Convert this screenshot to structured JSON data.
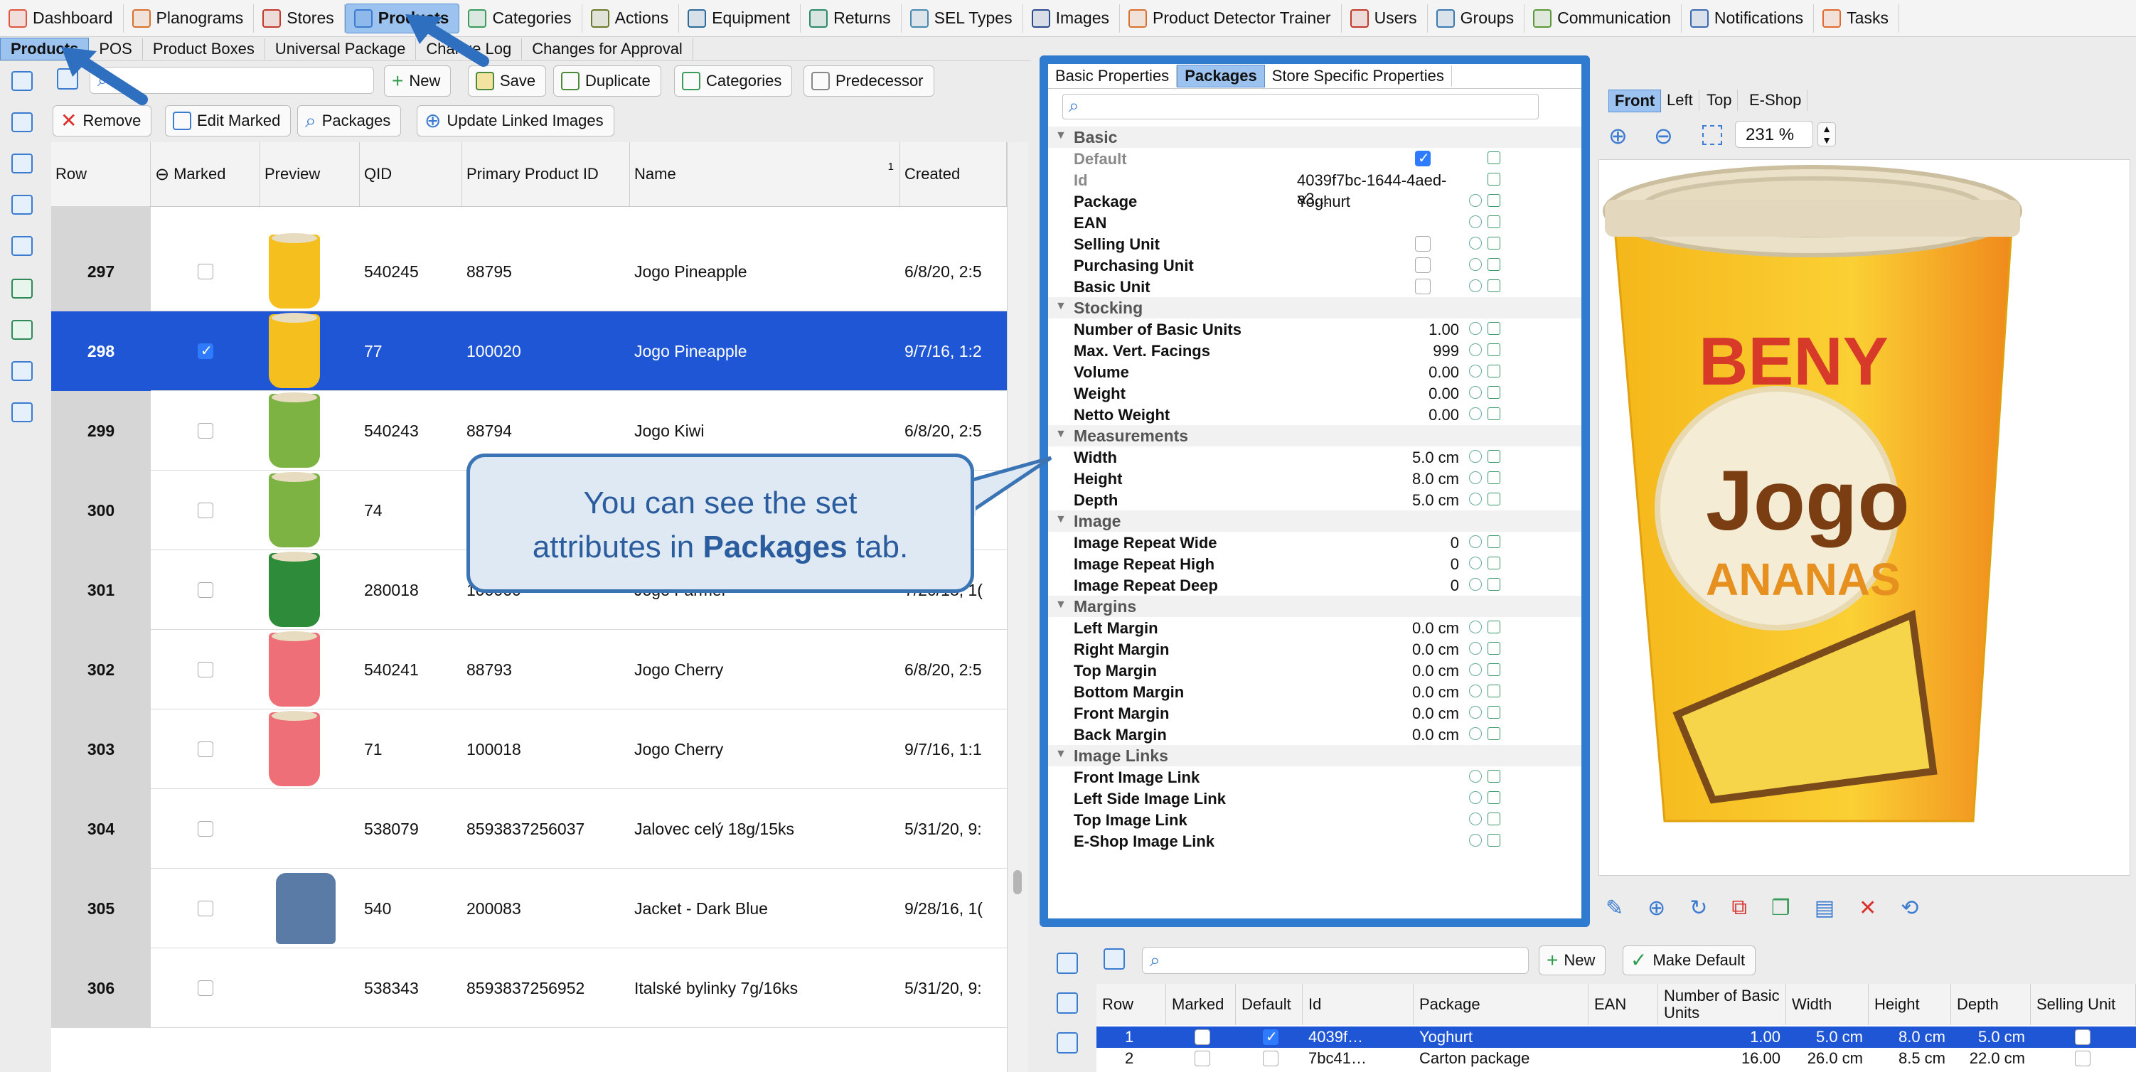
{
  "top_nav": [
    {
      "label": "Dashboard",
      "icon": "dashboard-icon",
      "color": "#e0553d"
    },
    {
      "label": "Planograms",
      "icon": "planogram-icon",
      "color": "#d9702e"
    },
    {
      "label": "Stores",
      "icon": "store-icon",
      "color": "#c0392b"
    },
    {
      "label": "Products",
      "icon": "products-icon",
      "color": "#3b7bd0",
      "active": true
    },
    {
      "label": "Categories",
      "icon": "categories-icon",
      "color": "#3a9b5a"
    },
    {
      "label": "Actions",
      "icon": "actions-icon",
      "color": "#6a7a2a"
    },
    {
      "label": "Equipment",
      "icon": "equipment-icon",
      "color": "#2b6a9b"
    },
    {
      "label": "Returns",
      "icon": "returns-icon",
      "color": "#2c8a6a"
    },
    {
      "label": "SEL Types",
      "icon": "sel-types-icon",
      "color": "#4a8ab0"
    },
    {
      "label": "Images",
      "icon": "images-icon",
      "color": "#2b4a8a"
    },
    {
      "label": "Product Detector Trainer",
      "icon": "detector-icon",
      "color": "#d9702e"
    },
    {
      "label": "Users",
      "icon": "users-icon",
      "color": "#c0392b"
    },
    {
      "label": "Groups",
      "icon": "groups-icon",
      "color": "#3a7ab0"
    },
    {
      "label": "Communication",
      "icon": "communication-icon",
      "color": "#5a9a3a"
    },
    {
      "label": "Notifications",
      "icon": "notifications-icon",
      "color": "#3b6ab0"
    },
    {
      "label": "Tasks",
      "icon": "tasks-icon",
      "color": "#e06a2e"
    }
  ],
  "sub_tabs": [
    {
      "label": "Products",
      "active": true
    },
    {
      "label": "POS"
    },
    {
      "label": "Product Boxes"
    },
    {
      "label": "Universal Package"
    },
    {
      "label": "Change Log"
    },
    {
      "label": "Changes for Approval"
    }
  ],
  "toolbar": {
    "new_label": "New",
    "save_label": "Save",
    "duplicate_label": "Duplicate",
    "categories_label": "Categories",
    "predecessor_label": "Predecessor",
    "remove_label": "Remove",
    "edit_marked_label": "Edit Marked",
    "packages_label": "Packages",
    "update_linked_label": "Update Linked Images"
  },
  "grid": {
    "columns": [
      "Row",
      "Marked",
      "Preview",
      "QID",
      "Primary Product ID",
      "Name",
      "Created"
    ],
    "sort_indicator": "1",
    "rows": [
      {
        "row": "297",
        "marked": false,
        "qid": "540245",
        "ppid": "88795",
        "name": "Jogo Pineapple",
        "created": "6/8/20, 2:5",
        "preview": "pineapple"
      },
      {
        "row": "298",
        "marked": true,
        "qid": "77",
        "ppid": "100020",
        "name": "Jogo Pineapple",
        "created": "9/7/16, 1:2",
        "preview": "pineapple",
        "selected": true
      },
      {
        "row": "299",
        "marked": false,
        "qid": "540243",
        "ppid": "88794",
        "name": "Jogo Kiwi",
        "created": "6/8/20, 2:5",
        "preview": "kiwi"
      },
      {
        "row": "300",
        "marked": false,
        "qid": "74",
        "ppid": "",
        "name": "",
        "created": ", 1:1",
        "preview": "kiwi"
      },
      {
        "row": "301",
        "marked": false,
        "qid": "280018",
        "ppid": "100060",
        "name": "Jogo Farmer",
        "created": "7/20/18, 1(",
        "preview": "farmer"
      },
      {
        "row": "302",
        "marked": false,
        "qid": "540241",
        "ppid": "88793",
        "name": "Jogo Cherry",
        "created": "6/8/20, 2:5",
        "preview": "cherry"
      },
      {
        "row": "303",
        "marked": false,
        "qid": "71",
        "ppid": "100018",
        "name": "Jogo Cherry",
        "created": "9/7/16, 1:1",
        "preview": "cherry"
      },
      {
        "row": "304",
        "marked": false,
        "qid": "538079",
        "ppid": "8593837256037",
        "name": "Jalovec celý 18g/15ks",
        "created": "5/31/20, 9:",
        "preview": ""
      },
      {
        "row": "305",
        "marked": false,
        "qid": "540",
        "ppid": "200083",
        "name": "Jacket - Dark Blue",
        "created": "9/28/16, 1(",
        "preview": "jacket"
      },
      {
        "row": "306",
        "marked": false,
        "qid": "538343",
        "ppid": "8593837256952",
        "name": "Italské bylinky 7g/16ks",
        "created": "5/31/20, 9:",
        "preview": ""
      }
    ]
  },
  "callout": {
    "line1": "You can see the set",
    "line2_pre": "attributes in ",
    "line2_bold": "Packages",
    "line2_post": " tab."
  },
  "props": {
    "tabs": [
      {
        "label": "Basic Properties"
      },
      {
        "label": "Packages",
        "active": true
      },
      {
        "label": "Store Specific Properties"
      }
    ],
    "groups": [
      {
        "name": "Basic",
        "items": [
          {
            "k": "Default",
            "type": "check",
            "checked": true,
            "muted": true
          },
          {
            "k": "Id",
            "v": "4039f7bc-1644-4aed-a3…",
            "muted": true
          },
          {
            "k": "Package",
            "v": "Yoghurt"
          },
          {
            "k": "EAN",
            "v": ""
          },
          {
            "k": "Selling Unit",
            "type": "check",
            "checked": false
          },
          {
            "k": "Purchasing Unit",
            "type": "check",
            "checked": false
          },
          {
            "k": "Basic Unit",
            "type": "check",
            "checked": false
          }
        ]
      },
      {
        "name": "Stocking",
        "items": [
          {
            "k": "Number of Basic Units",
            "vr": "1.00"
          },
          {
            "k": "Max. Vert. Facings",
            "vr": "999"
          },
          {
            "k": "Volume",
            "vr": "0.00"
          },
          {
            "k": "Weight",
            "vr": "0.00"
          },
          {
            "k": "Netto Weight",
            "vr": "0.00"
          }
        ]
      },
      {
        "name": "Measurements",
        "items": [
          {
            "k": "Width",
            "vr": "5.0 cm"
          },
          {
            "k": "Height",
            "vr": "8.0 cm"
          },
          {
            "k": "Depth",
            "vr": "5.0 cm"
          }
        ]
      },
      {
        "name": "Image",
        "items": [
          {
            "k": "Image Repeat Wide",
            "vr": "0"
          },
          {
            "k": "Image Repeat High",
            "vr": "0"
          },
          {
            "k": "Image Repeat Deep",
            "vr": "0"
          }
        ]
      },
      {
        "name": "Margins",
        "items": [
          {
            "k": "Left Margin",
            "vr": "0.0 cm"
          },
          {
            "k": "Right Margin",
            "vr": "0.0 cm"
          },
          {
            "k": "Top Margin",
            "vr": "0.0 cm"
          },
          {
            "k": "Bottom Margin",
            "vr": "0.0 cm"
          },
          {
            "k": "Front Margin",
            "vr": "0.0 cm"
          },
          {
            "k": "Back Margin",
            "vr": "0.0 cm"
          }
        ]
      },
      {
        "name": "Image Links",
        "items": [
          {
            "k": "Front Image Link",
            "v": ""
          },
          {
            "k": "Left Side Image Link",
            "v": ""
          },
          {
            "k": "Top Image Link",
            "v": ""
          },
          {
            "k": "E-Shop Image Link",
            "v": ""
          }
        ]
      }
    ]
  },
  "view_tabs": [
    {
      "label": "Front",
      "active": true
    },
    {
      "label": "Left"
    },
    {
      "label": "Top"
    },
    {
      "label": "E-Shop"
    }
  ],
  "zoom": "231 %",
  "preview_text": {
    "brand": "BENY",
    "name": "Jogo",
    "flavor": "ANANAS"
  },
  "bottom": {
    "new_label": "New",
    "make_default_label": "Make Default",
    "columns": [
      "Row",
      "Marked",
      "Default",
      "Id",
      "Package",
      "EAN",
      "Number of Basic Units",
      "Width",
      "Height",
      "Depth",
      "Selling Unit"
    ],
    "rows": [
      {
        "row": "1",
        "marked": false,
        "def": true,
        "id": "4039f…",
        "package": "Yoghurt",
        "ean": "",
        "nbu": "1.00",
        "w": "5.0 cm",
        "h": "8.0 cm",
        "d": "5.0 cm",
        "selected": true
      },
      {
        "row": "2",
        "marked": false,
        "def": false,
        "id": "7bc41…",
        "package": "Carton package",
        "ean": "",
        "nbu": "16.00",
        "w": "26.0 cm",
        "h": "8.5 cm",
        "d": "22.0 cm"
      }
    ]
  }
}
